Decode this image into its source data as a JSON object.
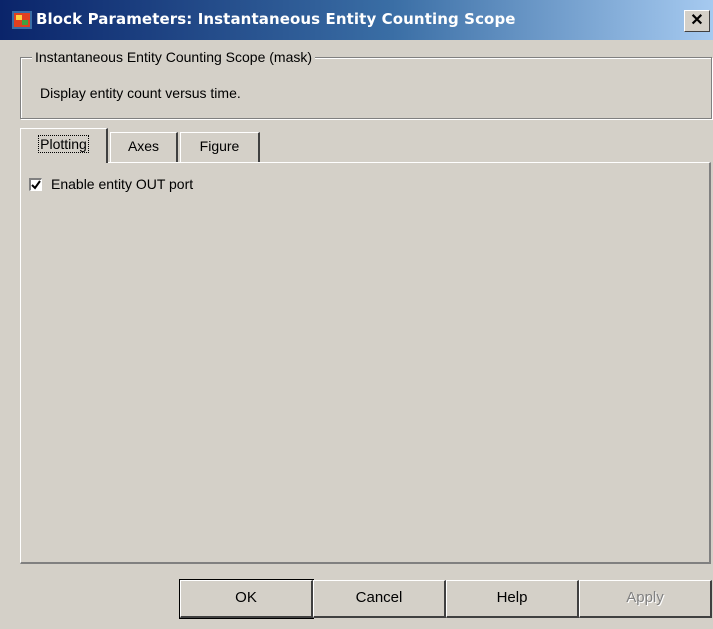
{
  "window": {
    "title": "Block Parameters: Instantaneous Entity Counting Scope",
    "close_glyph": "✕",
    "icon": "simulink-block-icon"
  },
  "group": {
    "legend": "Instantaneous Entity Counting Scope (mask)",
    "description": "Display entity count versus time."
  },
  "tabs": [
    {
      "label": "Plotting",
      "active": true
    },
    {
      "label": "Axes",
      "active": false
    },
    {
      "label": "Figure",
      "active": false
    }
  ],
  "plotting": {
    "enable_out_port": {
      "label": "Enable entity OUT port",
      "checked": true
    }
  },
  "buttons": {
    "ok": "OK",
    "cancel": "Cancel",
    "help": "Help",
    "apply": "Apply"
  },
  "colors": {
    "title_start": "#0a246a",
    "title_end": "#a6caf0",
    "face": "#d4d0c8"
  }
}
